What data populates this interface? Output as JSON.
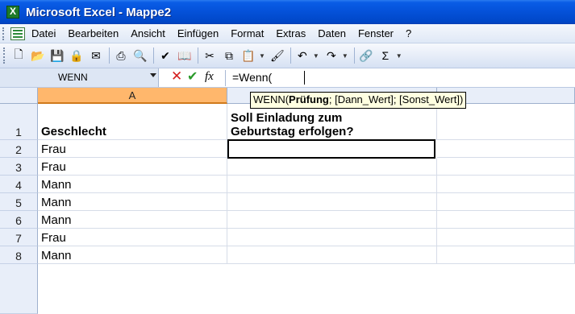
{
  "window": {
    "title": "Microsoft Excel - Mappe2"
  },
  "menu": {
    "items": [
      "Datei",
      "Bearbeiten",
      "Ansicht",
      "Einfügen",
      "Format",
      "Extras",
      "Daten",
      "Fenster",
      "?"
    ]
  },
  "toolbar": {
    "buttons": [
      {
        "name": "new-icon",
        "glyph": "🗋"
      },
      {
        "name": "open-icon",
        "glyph": "📂"
      },
      {
        "name": "save-icon",
        "glyph": "💾"
      },
      {
        "name": "permission-icon",
        "glyph": "🔒"
      },
      {
        "name": "email-icon",
        "glyph": "✉"
      },
      {
        "name": "print-icon",
        "glyph": "⎙"
      },
      {
        "name": "print-preview-icon",
        "glyph": "🔍"
      },
      {
        "name": "spelling-icon",
        "glyph": "✔"
      },
      {
        "name": "research-icon",
        "glyph": "📖"
      },
      {
        "name": "cut-icon",
        "glyph": "✂"
      },
      {
        "name": "copy-icon",
        "glyph": "⧉"
      },
      {
        "name": "paste-icon",
        "glyph": "📋"
      },
      {
        "name": "format-painter-icon",
        "glyph": "🖌"
      },
      {
        "name": "undo-icon",
        "glyph": "↶"
      },
      {
        "name": "redo-icon",
        "glyph": "↷"
      },
      {
        "name": "hyperlink-icon",
        "glyph": "🔗"
      },
      {
        "name": "autosum-icon",
        "glyph": "Σ"
      }
    ]
  },
  "formula_bar": {
    "name_box": "WENN",
    "formula": "=Wenn(",
    "fx_label": "fx"
  },
  "tooltip": {
    "prefix": "WENN(",
    "bold": "Prüfung",
    "rest": "; [Dann_Wert]; [Sonst_Wert])"
  },
  "columns": [
    "A",
    "",
    ""
  ],
  "rows": [
    {
      "num": "1",
      "a": "Geschlecht",
      "b1": "Soll Einladung zum",
      "b2": "Geburtstag erfolgen?"
    },
    {
      "num": "2",
      "a": "Frau",
      "b": ""
    },
    {
      "num": "3",
      "a": "Frau",
      "b": ""
    },
    {
      "num": "4",
      "a": "Mann",
      "b": ""
    },
    {
      "num": "5",
      "a": "Mann",
      "b": ""
    },
    {
      "num": "6",
      "a": "Mann",
      "b": ""
    },
    {
      "num": "7",
      "a": "Frau",
      "b": ""
    },
    {
      "num": "8",
      "a": "Mann",
      "b": ""
    }
  ]
}
